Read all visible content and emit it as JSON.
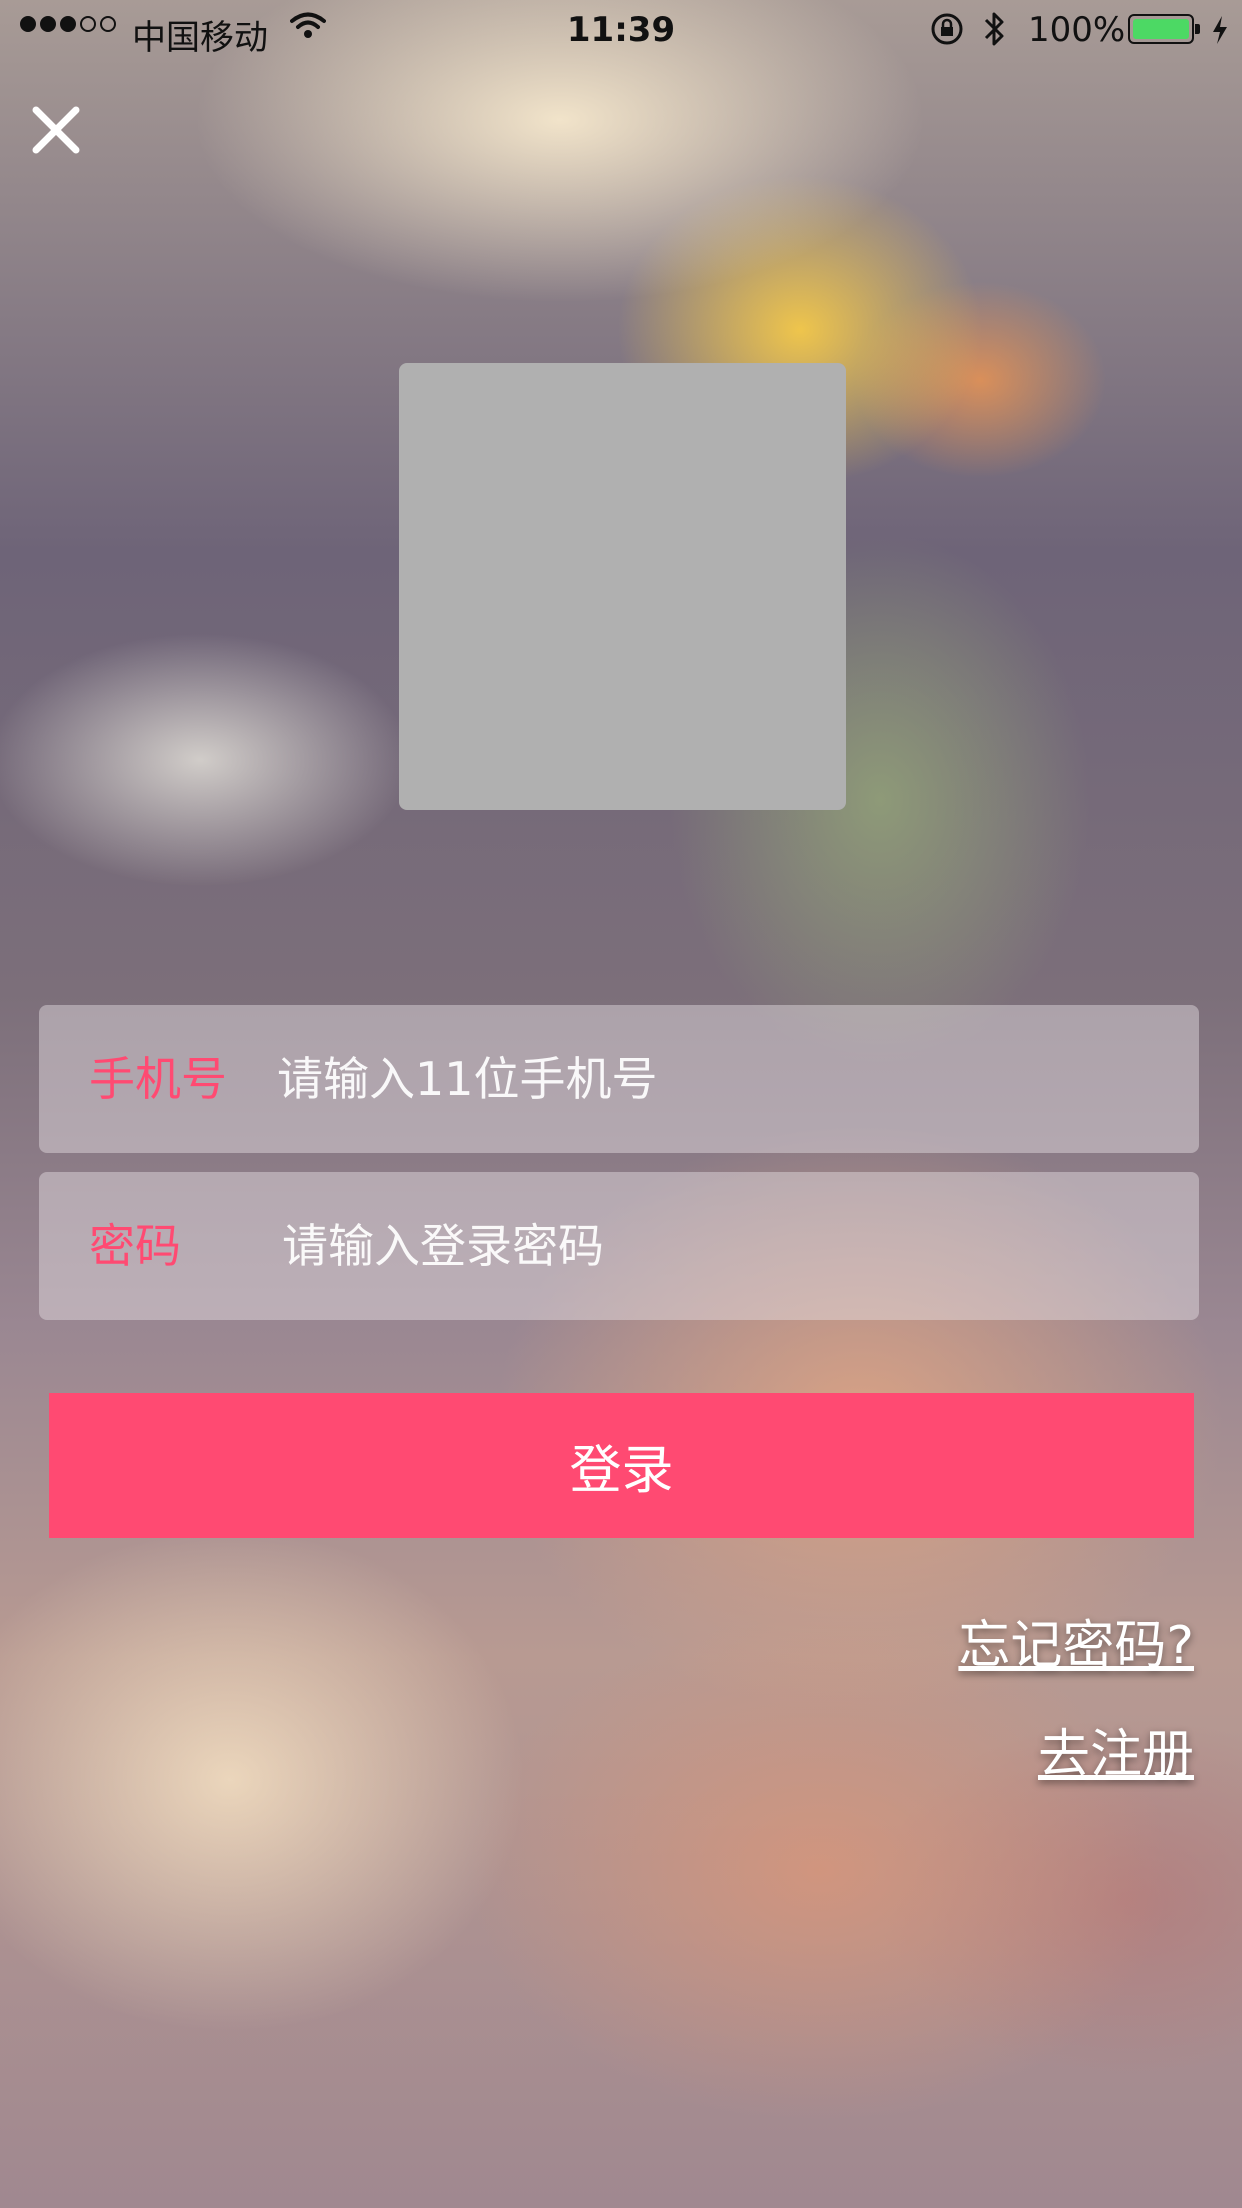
{
  "status_bar": {
    "carrier": "中国移动",
    "time": "11:39",
    "battery": "100%"
  },
  "form": {
    "phone_label": "手机号",
    "phone_placeholder": "请输入11位手机号",
    "password_label": "密码",
    "password_placeholder": "请输入登录密码",
    "login_label": "登录",
    "forgot_label": "忘记密码?",
    "register_label": "去注册"
  },
  "colors": {
    "accent": "#ff4a72",
    "battery": "#4cd964",
    "logo_placeholder": "#b0b0b0"
  },
  "icons": [
    "signal-icon",
    "wifi-icon",
    "rotation-lock-icon",
    "bluetooth-icon",
    "battery-icon",
    "charging-icon",
    "close-icon"
  ]
}
